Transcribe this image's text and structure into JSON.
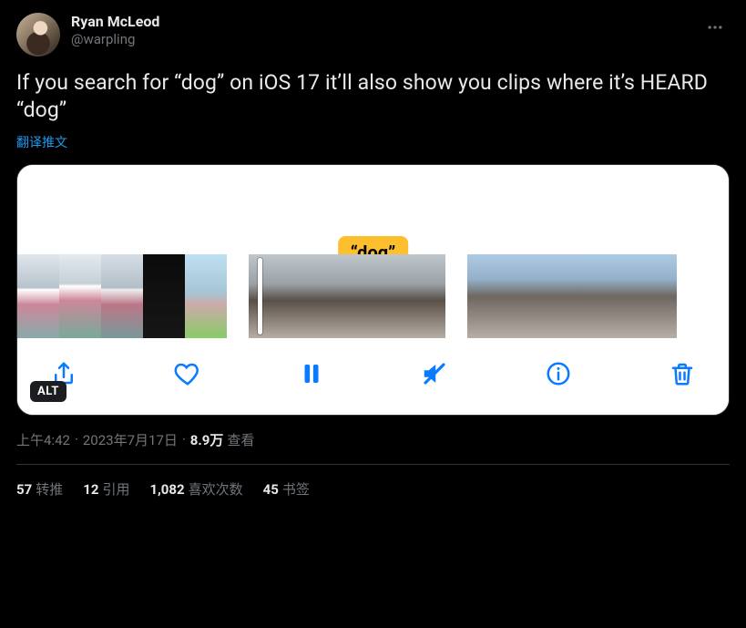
{
  "author": {
    "name": "Ryan McLeod",
    "handle": "@warpling"
  },
  "body": "If you search for “dog” on iOS 17 it’ll also show you clips where it’s HEARD “dog”",
  "translate_label": "翻译推文",
  "media": {
    "caption_overlay": "“dog”",
    "alt_badge": "ALT"
  },
  "toolbar_icons": {
    "share": "share-icon",
    "like": "heart-icon",
    "pause": "pause-icon",
    "mute": "mute-icon",
    "info": "info-icon",
    "delete": "trash-icon"
  },
  "meta": {
    "time": "上午4:42",
    "date": "2023年7月17日",
    "views_count": "8.9万",
    "views_label": "查看"
  },
  "stats": {
    "retweets": {
      "count": "57",
      "label": "转推"
    },
    "quotes": {
      "count": "12",
      "label": "引用"
    },
    "likes": {
      "count": "1,082",
      "label": "喜欢次数"
    },
    "bookmarks": {
      "count": "45",
      "label": "书签"
    }
  }
}
